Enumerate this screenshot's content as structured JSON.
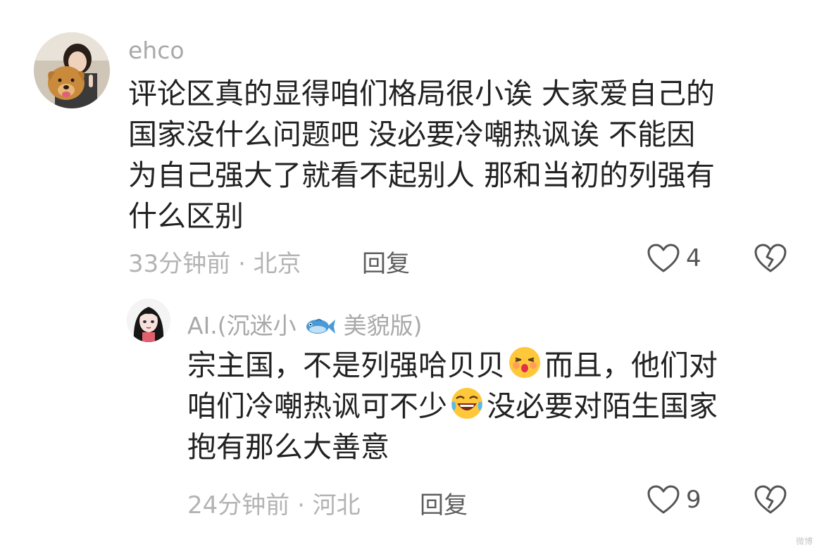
{
  "comment": {
    "username": "ehco",
    "lines": [
      "评论区真的显得咱们格局很小诶  大家爱自己的",
      "国家没什么问题吧  没必要冷嘲热讽诶   不能因",
      "为自己强大了就看不起别人  那和当初的列强有",
      "什么区别"
    ],
    "time": "33分钟前 · 北京",
    "reply_label": "回复",
    "likes": "4",
    "avatar_icon": "avatar-girl-with-dog-icon"
  },
  "reply": {
    "username_prefix": "AI.(沉迷小",
    "username_suffix": "美貌版)",
    "username_emoji": "fish-icon",
    "line1_a": "宗主国，不是列强哈贝贝",
    "line1_emoji": "kissing-face-icon",
    "line1_b": "而且，他们对",
    "line2_a": "咱们冷嘲热讽可不少",
    "line2_emoji": "rolling-laughing-icon",
    "line2_b": "没必要对陌生国家",
    "line3": "抱有那么大善意",
    "time": "24分钟前 · 河北",
    "reply_label": "回复",
    "likes": "9",
    "avatar_icon": "avatar-anime-girl-icon"
  },
  "watermark": "微博"
}
